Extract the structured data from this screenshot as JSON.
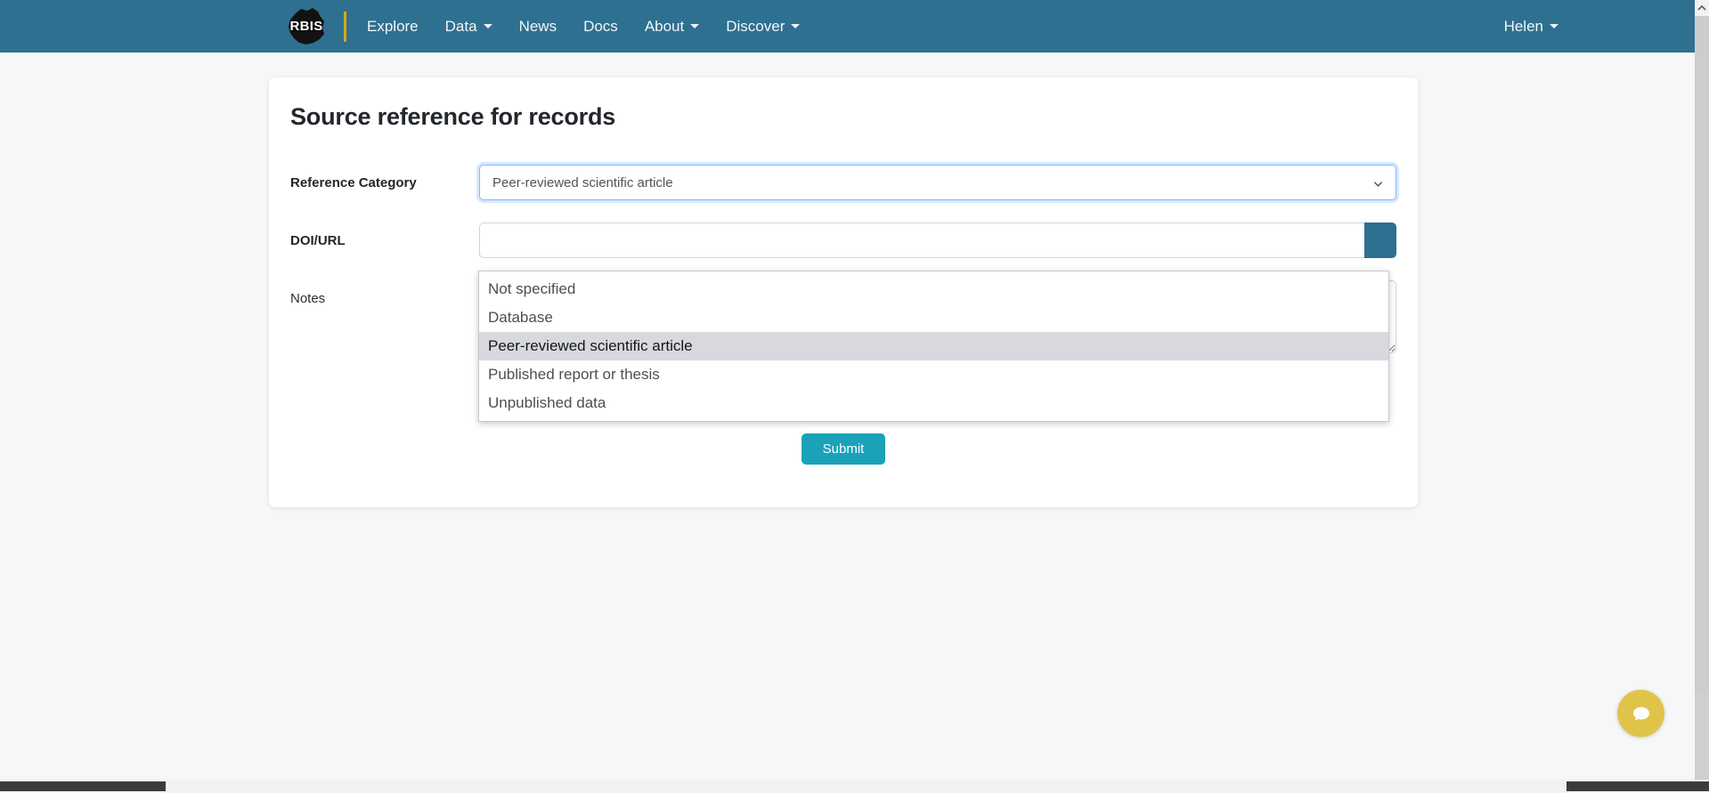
{
  "navbar": {
    "brand": {
      "logo_text": "RBIS",
      "logo_icon": "rwanda-map-icon"
    },
    "items": [
      {
        "label": "Explore",
        "has_caret": false
      },
      {
        "label": "Data",
        "has_caret": true
      },
      {
        "label": "News",
        "has_caret": false
      },
      {
        "label": "Docs",
        "has_caret": false
      },
      {
        "label": "About",
        "has_caret": true
      },
      {
        "label": "Discover",
        "has_caret": true
      }
    ],
    "user_menu": {
      "label": "Helen",
      "has_caret": true
    },
    "background_color": "#2e7090",
    "divider_color": "#d4aa18"
  },
  "card": {
    "title": "Source reference for records",
    "fields": {
      "category": {
        "label": "Reference Category",
        "selected_value": "Peer-reviewed scientific article",
        "expanded": true,
        "options": [
          "Not specified",
          "Database",
          "Peer-reviewed scientific article",
          "Published report or thesis",
          "Unpublished data"
        ],
        "selected_index": 2,
        "chevron_icon": "chevron-down-icon",
        "focus_border_color": "#86b7fe"
      },
      "doi": {
        "label": "DOI/URL",
        "value": "",
        "placeholder": "",
        "button_label": "",
        "button_color": "#2e7090"
      },
      "notes": {
        "label": "Notes",
        "value": "",
        "placeholder": ""
      }
    },
    "submit": {
      "label": "Submit",
      "color": "#19a2b8"
    }
  },
  "chat_widget": {
    "icon": "chat-bubble-icon",
    "color": "#e0c44a"
  }
}
